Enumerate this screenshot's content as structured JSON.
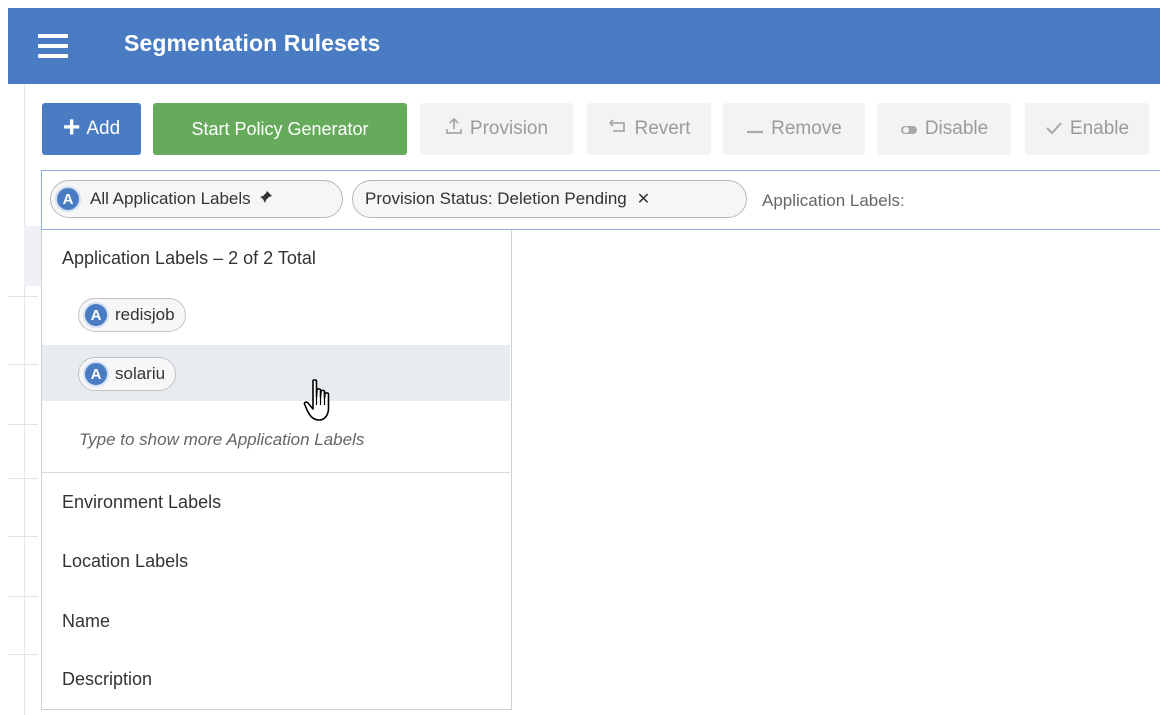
{
  "header": {
    "title": "Segmentation Rulesets",
    "menu_icon": "hamburger-icon"
  },
  "toolbar": {
    "add": {
      "label": "Add",
      "icon": "plus-icon"
    },
    "policy_generator": {
      "label": "Start Policy Generator"
    },
    "provision": {
      "label": "Provision",
      "icon": "upload-icon",
      "disabled": true
    },
    "revert": {
      "label": "Revert",
      "icon": "undo-icon",
      "disabled": true
    },
    "remove": {
      "label": "Remove",
      "icon": "minus-icon",
      "disabled": true
    },
    "disable": {
      "label": "Disable",
      "icon": "toggle-off-icon",
      "disabled": true
    },
    "enable": {
      "label": "Enable",
      "icon": "check-icon",
      "disabled": true
    }
  },
  "filter": {
    "chips": [
      {
        "label": "All Application Labels",
        "icon": "app-label-icon",
        "icon_text": "A",
        "action_icon": "pin-icon"
      },
      {
        "label": "Provision Status: Deletion Pending",
        "action_icon": "close-icon"
      }
    ],
    "input_placeholder": "Application Labels:"
  },
  "dropdown": {
    "heading": "Application Labels – 2 of 2 Total",
    "items": [
      {
        "label": "redisjob",
        "icon_text": "A"
      },
      {
        "label": "solariu",
        "icon_text": "A",
        "hovered": true
      }
    ],
    "hint": "Type to show more Application Labels",
    "categories": [
      "Environment Labels",
      "Location Labels",
      "Name",
      "Description"
    ]
  },
  "colors": {
    "header_bg": "#4a7cc4",
    "primary": "#4a7cc4",
    "success": "#66aa5c",
    "disabled_bg": "#f3f3f3",
    "hover_row": "#e8ebf0"
  }
}
